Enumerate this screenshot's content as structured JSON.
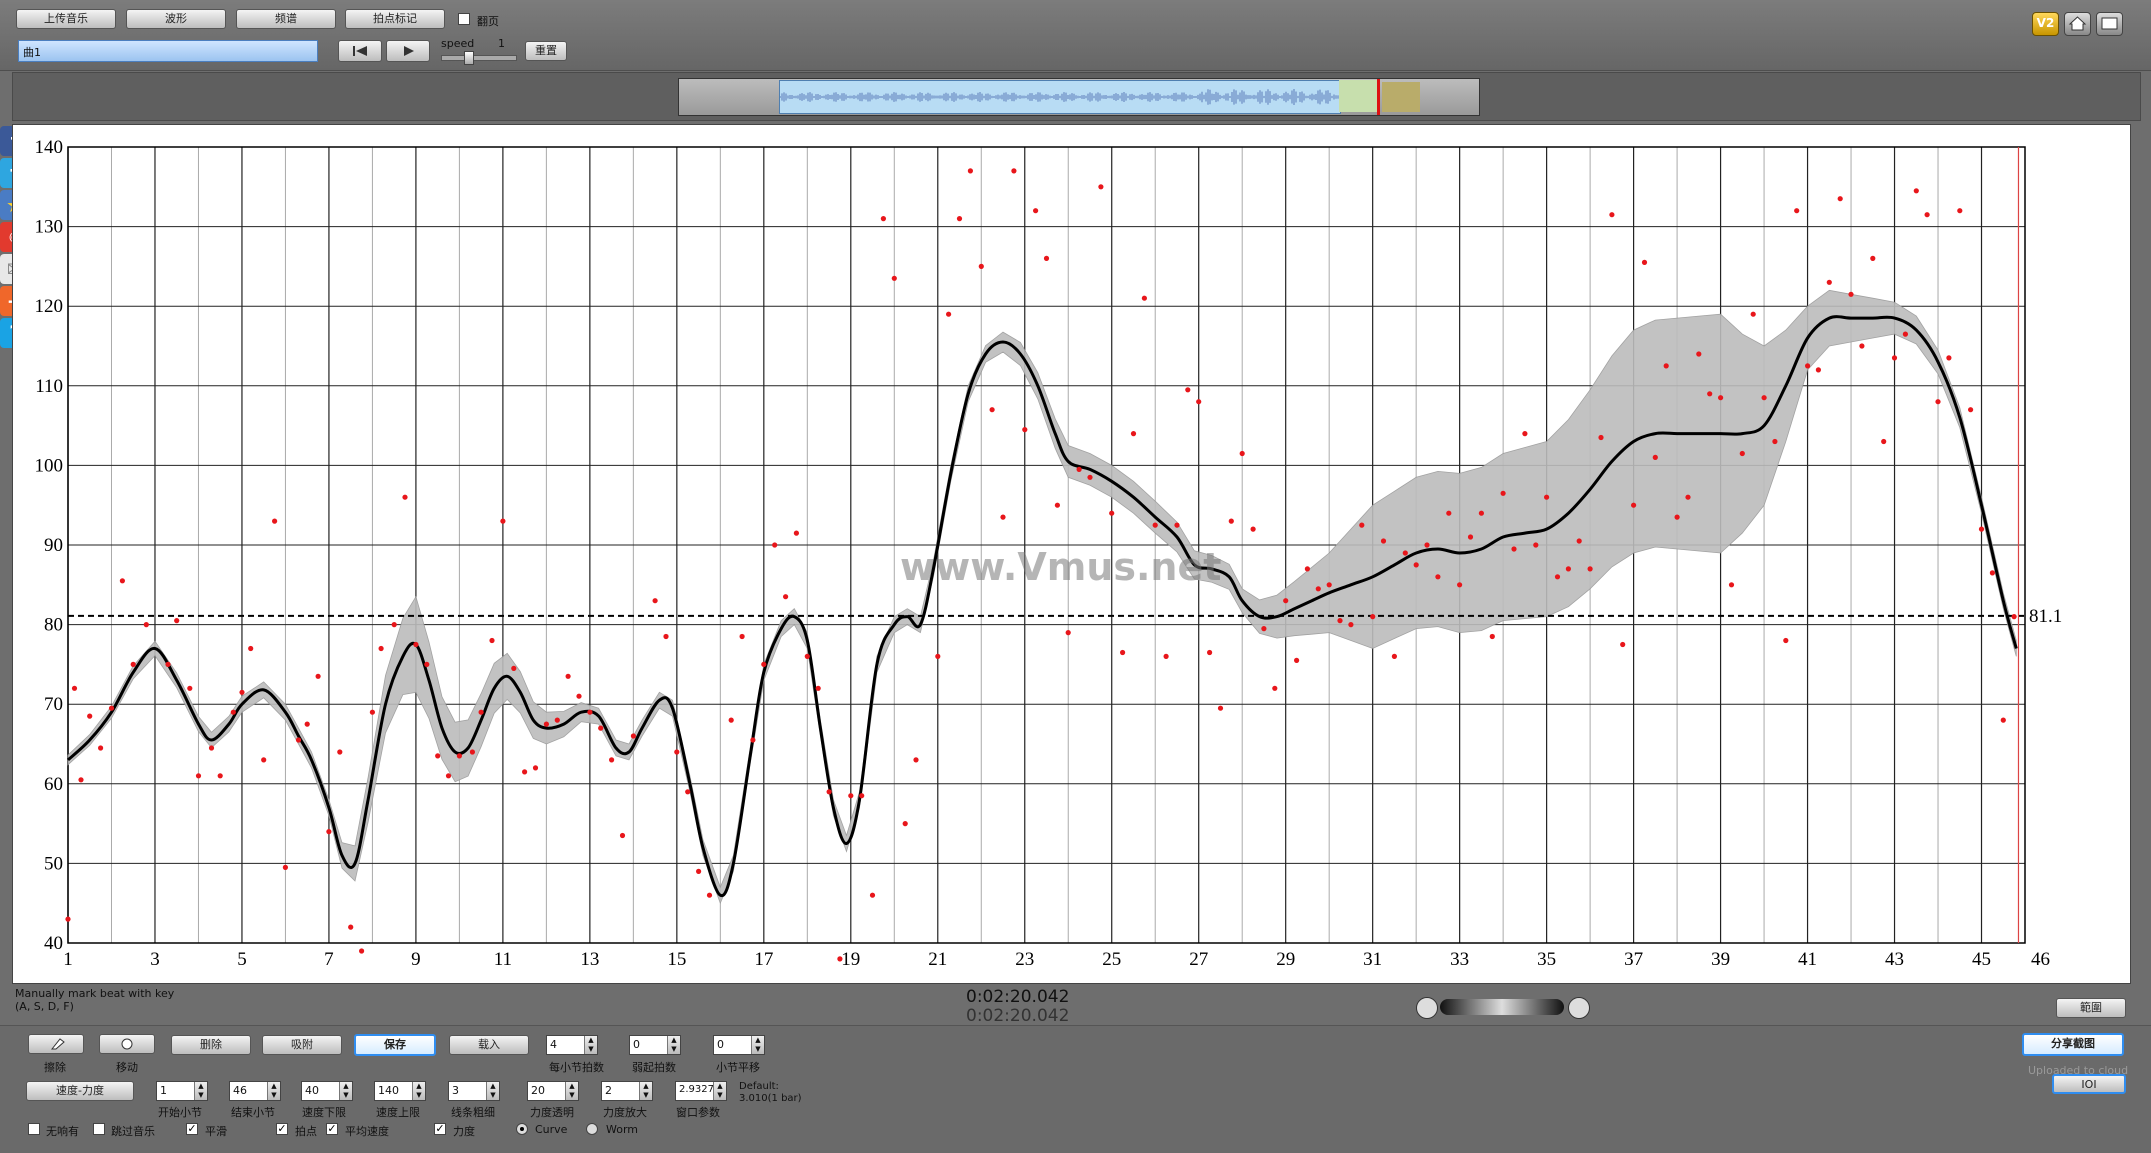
{
  "toolbar": {
    "upload": "上传音乐",
    "waveform": "波形",
    "spectrum": "频谱",
    "beat_mark": "拍点标记",
    "flip_label": "翻页",
    "track_input": "曲1",
    "speed_label": "speed",
    "speed_value": "1",
    "reset": "重置",
    "v2": "V2"
  },
  "status": {
    "hint_line1": "Manually mark beat with key",
    "hint_line2": "(A, S, D, F)",
    "time1": "0:02:20.042",
    "time2": "0:02:20.042",
    "range_button": "範圍"
  },
  "bottom": {
    "erase": "擦除",
    "move": "移动",
    "delete": "删除",
    "adsorb": "吸附",
    "save": "保存",
    "import": "载入",
    "beats_per_bar_label": "每小节拍数",
    "beats_per_bar": "4",
    "weak_beats_label": "弱起拍数",
    "weak_beats": "0",
    "bar_offset_label": "小节平移",
    "bar_offset": "0",
    "mode_select": "速度-力度",
    "start_bar_label": "开始小节",
    "start_bar": "1",
    "end_bar_label": "结束小节",
    "end_bar": "46",
    "tempo_min_label": "速度下限",
    "tempo_min": "40",
    "tempo_max_label": "速度上限",
    "tempo_max": "140",
    "line_width_label": "线条粗细",
    "line_width": "3",
    "dyn_alpha_label": "力度透明",
    "dyn_alpha": "20",
    "dyn_scale_label": "力度放大",
    "dyn_scale": "2",
    "window_label": "窗口参数",
    "window_value": "2.93276",
    "default_line1": "Default:",
    "default_line2": "3.010(1 bar)",
    "no_crop": "无响有",
    "skip_music": "跳过音乐",
    "smooth": "平滑",
    "beat_point": "拍点",
    "avg_tempo": "平均速度",
    "dynamics": "力度",
    "curve": "Curve",
    "worm": "Worm",
    "share_button": "分享截图",
    "uploaded_text": "Uploaded to cloud",
    "ioi_button": "IOI"
  },
  "watermark": "www.Vmus.net",
  "chart_data": {
    "type": "scatter",
    "title": "",
    "xlabel": "",
    "ylabel": "",
    "xlim": [
      1,
      46
    ],
    "ylim": [
      40,
      140
    ],
    "x_ticks": [
      1,
      3,
      5,
      7,
      9,
      11,
      13,
      15,
      17,
      19,
      21,
      23,
      25,
      27,
      29,
      31,
      33,
      35,
      37,
      39,
      41,
      43,
      45,
      46
    ],
    "y_ticks": [
      40,
      50,
      60,
      70,
      80,
      90,
      100,
      110,
      120,
      130,
      140
    ],
    "average_tempo": 81.1,
    "average_label": "81.1",
    "grid": true,
    "point_color": "#e8161b",
    "curve_color": "#000000",
    "band_color": "#bcbcbc",
    "curve": [
      [
        1,
        63
      ],
      [
        1.5,
        65.5
      ],
      [
        2,
        69
      ],
      [
        2.5,
        74
      ],
      [
        3,
        77
      ],
      [
        3.5,
        73
      ],
      [
        4,
        67.5
      ],
      [
        4.3,
        65.5
      ],
      [
        4.7,
        67.5
      ],
      [
        5,
        70
      ],
      [
        5.5,
        71.8
      ],
      [
        6,
        69
      ],
      [
        6.3,
        66
      ],
      [
        6.6,
        63
      ],
      [
        7,
        57
      ],
      [
        7.3,
        51
      ],
      [
        7.6,
        50
      ],
      [
        7.9,
        58
      ],
      [
        8.3,
        70
      ],
      [
        8.7,
        76
      ],
      [
        9,
        77.5
      ],
      [
        9.3,
        73
      ],
      [
        9.6,
        67
      ],
      [
        9.9,
        64
      ],
      [
        10.2,
        64.5
      ],
      [
        10.5,
        68
      ],
      [
        10.8,
        72
      ],
      [
        11.1,
        73.5
      ],
      [
        11.4,
        71.5
      ],
      [
        11.7,
        68
      ],
      [
        12,
        67
      ],
      [
        12.4,
        67.5
      ],
      [
        12.8,
        69
      ],
      [
        13.2,
        68.5
      ],
      [
        13.6,
        64.5
      ],
      [
        13.9,
        64
      ],
      [
        14.2,
        67
      ],
      [
        14.6,
        70.5
      ],
      [
        14.9,
        69.5
      ],
      [
        15.3,
        60
      ],
      [
        15.6,
        52
      ],
      [
        16,
        46
      ],
      [
        16.3,
        50
      ],
      [
        16.7,
        64
      ],
      [
        17,
        74
      ],
      [
        17.4,
        79.5
      ],
      [
        17.7,
        81
      ],
      [
        18,
        78
      ],
      [
        18.3,
        67
      ],
      [
        18.6,
        57
      ],
      [
        18.9,
        52.5
      ],
      [
        19.2,
        58
      ],
      [
        19.6,
        75
      ],
      [
        20,
        80
      ],
      [
        20.3,
        81
      ],
      [
        20.6,
        80
      ],
      [
        20.9,
        87
      ],
      [
        21.3,
        99
      ],
      [
        21.7,
        109
      ],
      [
        22.1,
        114
      ],
      [
        22.5,
        115.5
      ],
      [
        22.9,
        114
      ],
      [
        23.3,
        110
      ],
      [
        23.7,
        104
      ],
      [
        24,
        100.5
      ],
      [
        24.5,
        99.5
      ],
      [
        25,
        98
      ],
      [
        25.5,
        96
      ],
      [
        26,
        93.5
      ],
      [
        26.5,
        91
      ],
      [
        26.9,
        87.5
      ],
      [
        27.3,
        87
      ],
      [
        27.7,
        86
      ],
      [
        28,
        83
      ],
      [
        28.4,
        81
      ],
      [
        28.8,
        81
      ],
      [
        29.2,
        82
      ],
      [
        29.6,
        83
      ],
      [
        30,
        84
      ],
      [
        30.5,
        85
      ],
      [
        31,
        86
      ],
      [
        31.5,
        87.5
      ],
      [
        32,
        89
      ],
      [
        32.5,
        89.5
      ],
      [
        33,
        89
      ],
      [
        33.5,
        89.5
      ],
      [
        34,
        91
      ],
      [
        34.5,
        91.5
      ],
      [
        35,
        92
      ],
      [
        35.5,
        94
      ],
      [
        36,
        97
      ],
      [
        36.5,
        100.5
      ],
      [
        37,
        103
      ],
      [
        37.5,
        104
      ],
      [
        38,
        104
      ],
      [
        38.5,
        104
      ],
      [
        39,
        104
      ],
      [
        39.5,
        104
      ],
      [
        40,
        105
      ],
      [
        40.5,
        110
      ],
      [
        41,
        116
      ],
      [
        41.5,
        118.5
      ],
      [
        42,
        118.5
      ],
      [
        42.5,
        118.5
      ],
      [
        43,
        118.5
      ],
      [
        43.5,
        117
      ],
      [
        44,
        113
      ],
      [
        44.5,
        106
      ],
      [
        45,
        95
      ],
      [
        45.5,
        83
      ],
      [
        45.8,
        77
      ]
    ],
    "band": [
      [
        1,
        0.6
      ],
      [
        3,
        0.9
      ],
      [
        5,
        1
      ],
      [
        7,
        1
      ],
      [
        8.5,
        4
      ],
      [
        9,
        6
      ],
      [
        9.5,
        4
      ],
      [
        11,
        3
      ],
      [
        13,
        1
      ],
      [
        15,
        1
      ],
      [
        17,
        1
      ],
      [
        19,
        1
      ],
      [
        22,
        1
      ],
      [
        24,
        2
      ],
      [
        26,
        2
      ],
      [
        28,
        1.5
      ],
      [
        29,
        3
      ],
      [
        30,
        5
      ],
      [
        31,
        9
      ],
      [
        33,
        10
      ],
      [
        35,
        11
      ],
      [
        37,
        14
      ],
      [
        39,
        15
      ],
      [
        40,
        10
      ],
      [
        41,
        4
      ],
      [
        43,
        2
      ],
      [
        45,
        1
      ],
      [
        46,
        1
      ]
    ],
    "points": [
      [
        1,
        43
      ],
      [
        1.15,
        72
      ],
      [
        1.3,
        60.5
      ],
      [
        1.5,
        68.5
      ],
      [
        1.75,
        64.5
      ],
      [
        2,
        69.5
      ],
      [
        2.25,
        85.5
      ],
      [
        2.5,
        75
      ],
      [
        2.8,
        80
      ],
      [
        3.3,
        75
      ],
      [
        3.5,
        80.5
      ],
      [
        3.8,
        72
      ],
      [
        4,
        61
      ],
      [
        4.3,
        64.5
      ],
      [
        4.5,
        61
      ],
      [
        4.8,
        69
      ],
      [
        5,
        71.5
      ],
      [
        5.2,
        77
      ],
      [
        5.5,
        63
      ],
      [
        5.75,
        93
      ],
      [
        6,
        49.5
      ],
      [
        6.3,
        65.5
      ],
      [
        6.5,
        67.5
      ],
      [
        6.75,
        73.5
      ],
      [
        7,
        54
      ],
      [
        7.25,
        64
      ],
      [
        7.5,
        42
      ],
      [
        7.75,
        39
      ],
      [
        8,
        69
      ],
      [
        8.2,
        77
      ],
      [
        8.5,
        80
      ],
      [
        8.75,
        96
      ],
      [
        9,
        77.5
      ],
      [
        9.25,
        75
      ],
      [
        9.5,
        63.5
      ],
      [
        9.75,
        61
      ],
      [
        10,
        63.5
      ],
      [
        10.3,
        64
      ],
      [
        10.5,
        69
      ],
      [
        10.75,
        78
      ],
      [
        11,
        93
      ],
      [
        11.25,
        74.5
      ],
      [
        11.5,
        61.5
      ],
      [
        11.75,
        62
      ],
      [
        12,
        67.5
      ],
      [
        12.25,
        68
      ],
      [
        12.5,
        73.5
      ],
      [
        12.75,
        71
      ],
      [
        13,
        69
      ],
      [
        13.25,
        67
      ],
      [
        13.5,
        63
      ],
      [
        13.75,
        53.5
      ],
      [
        14,
        66
      ],
      [
        14.5,
        83
      ],
      [
        14.75,
        78.5
      ],
      [
        15,
        64
      ],
      [
        15.25,
        59
      ],
      [
        15.5,
        49
      ],
      [
        15.75,
        46
      ],
      [
        16.25,
        68
      ],
      [
        16.5,
        78.5
      ],
      [
        16.75,
        65.5
      ],
      [
        17,
        75
      ],
      [
        17.25,
        90
      ],
      [
        17.5,
        83.5
      ],
      [
        17.75,
        91.5
      ],
      [
        18,
        76
      ],
      [
        18.25,
        72
      ],
      [
        18.5,
        59
      ],
      [
        18.75,
        38
      ],
      [
        19,
        58.5
      ],
      [
        19.25,
        58.5
      ],
      [
        19.5,
        46
      ],
      [
        19.75,
        131
      ],
      [
        20,
        123.5
      ],
      [
        20.25,
        55
      ],
      [
        20.5,
        63
      ],
      [
        21,
        76
      ],
      [
        21.25,
        119
      ],
      [
        21.5,
        131
      ],
      [
        21.75,
        137
      ],
      [
        22,
        125
      ],
      [
        22.25,
        107
      ],
      [
        22.5,
        93.5
      ],
      [
        22.75,
        137
      ],
      [
        23,
        104.5
      ],
      [
        23.25,
        132
      ],
      [
        23.5,
        126
      ],
      [
        23.75,
        95
      ],
      [
        24,
        79
      ],
      [
        24.25,
        99.5
      ],
      [
        24.5,
        98.5
      ],
      [
        24.75,
        135
      ],
      [
        25,
        94
      ],
      [
        25.25,
        76.5
      ],
      [
        25.5,
        104
      ],
      [
        25.75,
        121
      ],
      [
        26,
        92.5
      ],
      [
        26.25,
        76
      ],
      [
        26.5,
        92.5
      ],
      [
        26.75,
        109.5
      ],
      [
        27,
        108
      ],
      [
        27.25,
        76.5
      ],
      [
        27.5,
        69.5
      ],
      [
        27.75,
        93
      ],
      [
        28,
        101.5
      ],
      [
        28.25,
        92
      ],
      [
        28.5,
        79.5
      ],
      [
        28.75,
        72
      ],
      [
        29,
        83
      ],
      [
        29.25,
        75.5
      ],
      [
        29.5,
        87
      ],
      [
        29.75,
        84.5
      ],
      [
        30,
        85
      ],
      [
        30.25,
        80.5
      ],
      [
        30.5,
        80
      ],
      [
        30.75,
        92.5
      ],
      [
        31,
        81
      ],
      [
        31.25,
        90.5
      ],
      [
        31.5,
        76
      ],
      [
        31.75,
        89
      ],
      [
        32,
        87.5
      ],
      [
        32.25,
        90
      ],
      [
        32.5,
        86
      ],
      [
        32.75,
        94
      ],
      [
        33,
        85
      ],
      [
        33.25,
        91
      ],
      [
        33.5,
        94
      ],
      [
        33.75,
        78.5
      ],
      [
        34,
        96.5
      ],
      [
        34.25,
        89.5
      ],
      [
        34.5,
        104
      ],
      [
        34.75,
        90
      ],
      [
        35,
        96
      ],
      [
        35.25,
        86
      ],
      [
        35.5,
        87
      ],
      [
        35.75,
        90.5
      ],
      [
        36,
        87
      ],
      [
        36.25,
        103.5
      ],
      [
        36.5,
        131.5
      ],
      [
        36.75,
        77.5
      ],
      [
        37,
        95
      ],
      [
        37.25,
        125.5
      ],
      [
        37.5,
        101
      ],
      [
        37.75,
        112.5
      ],
      [
        38,
        93.5
      ],
      [
        38.25,
        96
      ],
      [
        38.5,
        114
      ],
      [
        38.75,
        109
      ],
      [
        39,
        108.5
      ],
      [
        39.25,
        85
      ],
      [
        39.5,
        101.5
      ],
      [
        39.75,
        119
      ],
      [
        40,
        108.5
      ],
      [
        40.25,
        103
      ],
      [
        40.5,
        78
      ],
      [
        40.75,
        132
      ],
      [
        41,
        112.5
      ],
      [
        41.25,
        112
      ],
      [
        41.5,
        123
      ],
      [
        41.75,
        133.5
      ],
      [
        42,
        121.5
      ],
      [
        42.25,
        115
      ],
      [
        42.5,
        126
      ],
      [
        42.75,
        103
      ],
      [
        43,
        113.5
      ],
      [
        43.25,
        116.5
      ],
      [
        43.5,
        134.5
      ],
      [
        43.75,
        131.5
      ],
      [
        44,
        108
      ],
      [
        44.25,
        113.5
      ],
      [
        44.5,
        132
      ],
      [
        44.75,
        107
      ],
      [
        45,
        92
      ],
      [
        45.25,
        86.5
      ],
      [
        45.5,
        68
      ],
      [
        45.75,
        81
      ]
    ]
  }
}
